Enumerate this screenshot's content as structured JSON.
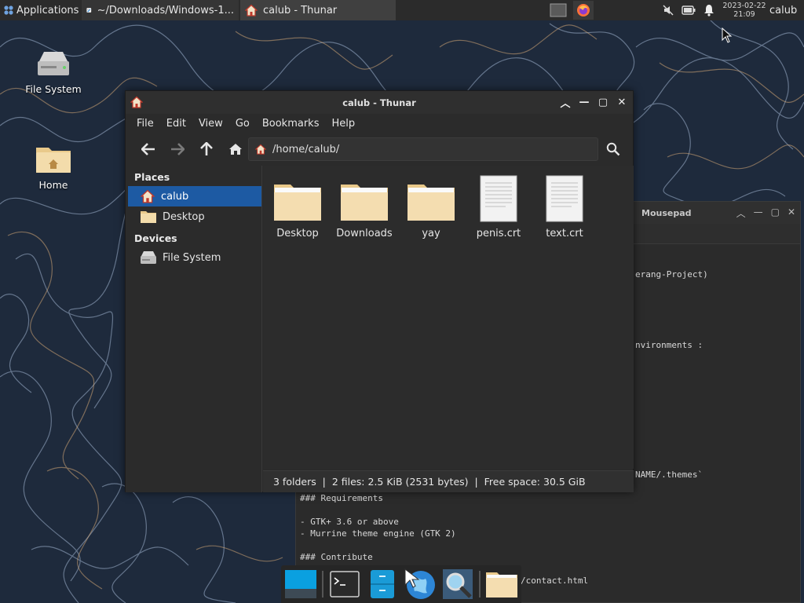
{
  "panel": {
    "applications_label": "Applications",
    "tasks": [
      {
        "label": "~/Downloads/Windows-1..."
      },
      {
        "label": "calub - Thunar"
      }
    ],
    "clock_date": "2023-02-22",
    "clock_time": "21:09",
    "user": "calub"
  },
  "desktop": {
    "icons": [
      {
        "label": "File System"
      },
      {
        "label": "Home"
      }
    ]
  },
  "mousepad": {
    "title": "Mousepad",
    "lines": [
      "erang-Project)",
      "nvironments :",
      "NAME/.themes`",
      "### Requirements",
      "",
      "- GTK+ 3.6 or above",
      "- Murrine theme engine (GTK 2)",
      "",
      "### Contribute",
      "/contact.html"
    ]
  },
  "thunar": {
    "title": "calub - Thunar",
    "menu": [
      "File",
      "Edit",
      "View",
      "Go",
      "Bookmarks",
      "Help"
    ],
    "location": "/home/calub/",
    "sidebar": {
      "places_header": "Places",
      "places": [
        {
          "label": "calub",
          "selected": true
        },
        {
          "label": "Desktop",
          "selected": false
        }
      ],
      "devices_header": "Devices",
      "devices": [
        {
          "label": "File System"
        }
      ]
    },
    "files": [
      {
        "label": "Desktop",
        "type": "folder"
      },
      {
        "label": "Downloads",
        "type": "folder"
      },
      {
        "label": "yay",
        "type": "folder"
      },
      {
        "label": "penis.crt",
        "type": "file"
      },
      {
        "label": "text.crt",
        "type": "file"
      }
    ],
    "status": "3 folders  |  2 files: 2.5 KiB (2531 bytes)  |  Free space: 30.5 GiB"
  },
  "colors": {
    "selection": "#1d5aa3",
    "panel": "#2b2b2b",
    "window": "#2b2b2b",
    "folder": "#f2d9a8"
  }
}
